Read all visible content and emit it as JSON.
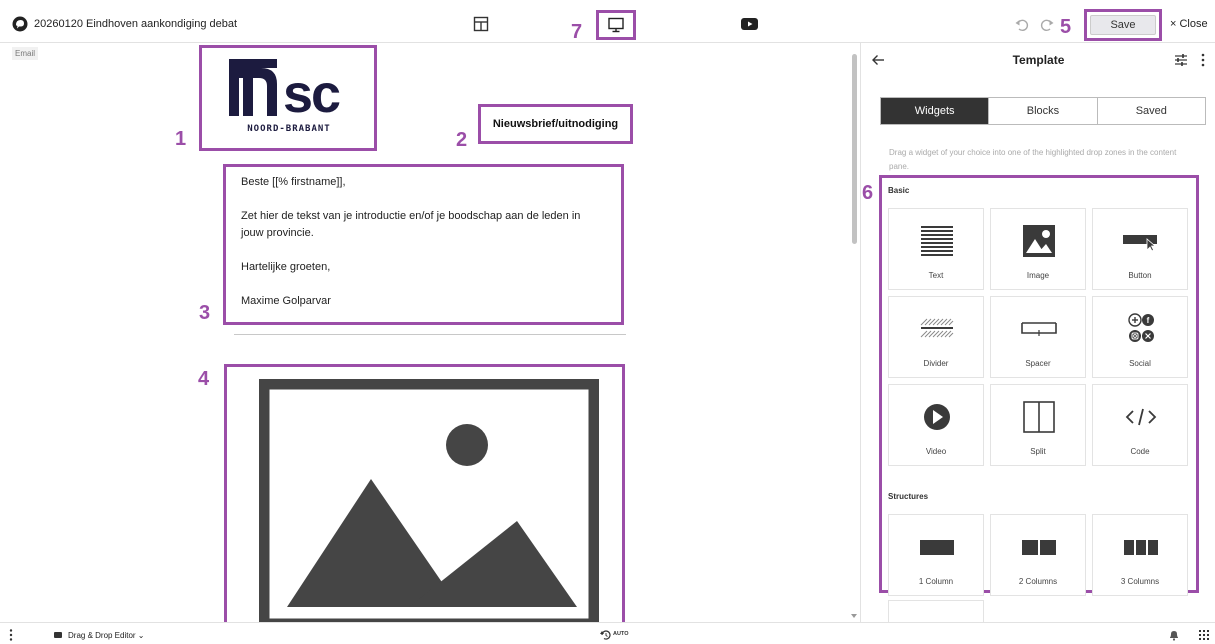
{
  "header": {
    "title": "20260120 Eindhoven aankondiging debat",
    "save_label": "Save",
    "close_label": "× Close"
  },
  "callouts": [
    "1",
    "2",
    "3",
    "4",
    "5",
    "6",
    "7"
  ],
  "canvas": {
    "email_tag": "Email",
    "logo": {
      "main": "nsc",
      "sub": "NOORD-BRABANT"
    },
    "heading": "Nieuwsbrief/uitnodiging",
    "body_paragraphs": [
      "Beste [[% firstname]],",
      "Zet hier de tekst van je introductie en/of je boodschap aan de leden in jouw provincie.",
      "Hartelijke groeten,",
      "Maxime Golparvar"
    ]
  },
  "panel": {
    "title": "Template",
    "tabs": [
      {
        "label": "Widgets",
        "active": true
      },
      {
        "label": "Blocks",
        "active": false
      },
      {
        "label": "Saved",
        "active": false
      }
    ],
    "hint": "Drag a widget of your choice into one of the highlighted drop zones in the content pane.",
    "basic_label": "Basic",
    "structures_label": "Structures",
    "widgets": [
      {
        "label": "Text",
        "icon": "text-widget-icon"
      },
      {
        "label": "Image",
        "icon": "image-widget-icon"
      },
      {
        "label": "Button",
        "icon": "button-widget-icon"
      },
      {
        "label": "Divider",
        "icon": "divider-widget-icon"
      },
      {
        "label": "Spacer",
        "icon": "spacer-widget-icon"
      },
      {
        "label": "Social",
        "icon": "social-widget-icon"
      },
      {
        "label": "Video",
        "icon": "video-widget-icon"
      },
      {
        "label": "Split",
        "icon": "split-widget-icon"
      },
      {
        "label": "Code",
        "icon": "code-widget-icon"
      }
    ],
    "structures": [
      {
        "label": "1 Column",
        "icon": "one-column-icon"
      },
      {
        "label": "2 Columns",
        "icon": "two-columns-icon"
      },
      {
        "label": "3 Columns",
        "icon": "three-columns-icon"
      }
    ]
  },
  "footer": {
    "editor_label": "Drag & Drop Editor ⌄",
    "auto_label": "AUTO"
  },
  "colors": {
    "highlight": "#9b4ea8",
    "logo_navy": "#1c1b3f",
    "icon_dark": "#3a3a3a"
  }
}
